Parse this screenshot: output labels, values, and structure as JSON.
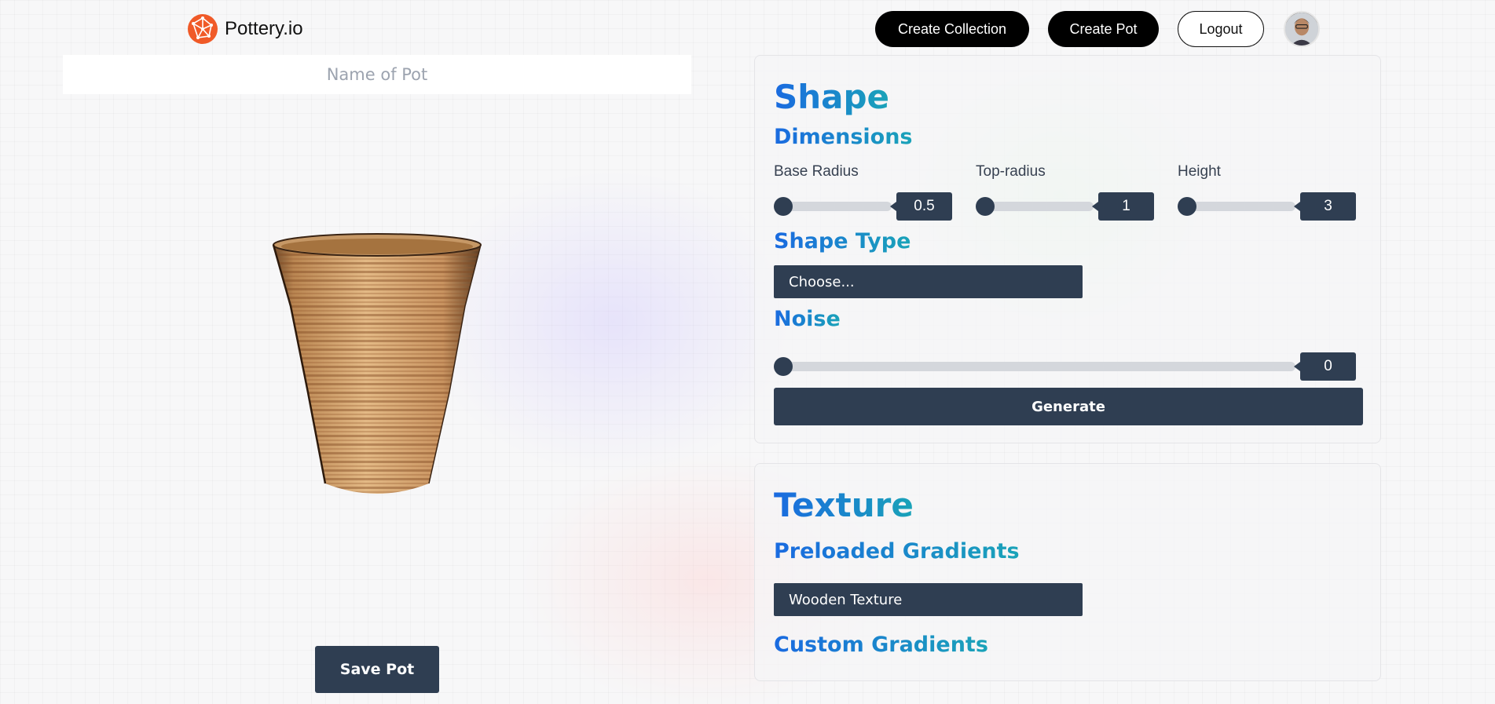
{
  "app": {
    "name": "Pottery.io"
  },
  "nav": {
    "create_collection": "Create Collection",
    "create_pot": "Create Pot",
    "logout": "Logout"
  },
  "left": {
    "name_placeholder": "Name of Pot",
    "save_label": "Save Pot"
  },
  "shape": {
    "title": "Shape",
    "dimensions_title": "Dimensions",
    "base_radius": {
      "label": "Base Radius",
      "value": "0.5"
    },
    "top_radius": {
      "label": "Top-radius",
      "value": "1"
    },
    "height": {
      "label": "Height",
      "value": "3"
    },
    "shape_type_title": "Shape Type",
    "shape_type_value": "Choose...",
    "noise_title": "Noise",
    "noise_value": "0",
    "generate_label": "Generate"
  },
  "texture": {
    "title": "Texture",
    "preloaded_title": "Preloaded Gradients",
    "preloaded_value": "Wooden Texture",
    "custom_title": "Custom Gradients"
  },
  "colors": {
    "accent_dark": "#2f3e52",
    "heading_gradient_start": "#1a6ae0",
    "heading_gradient_end": "#1aa3b8",
    "logo_orange": "#f05a28"
  },
  "icons": {
    "logo": "globe-network-icon",
    "avatar": "user-avatar"
  }
}
